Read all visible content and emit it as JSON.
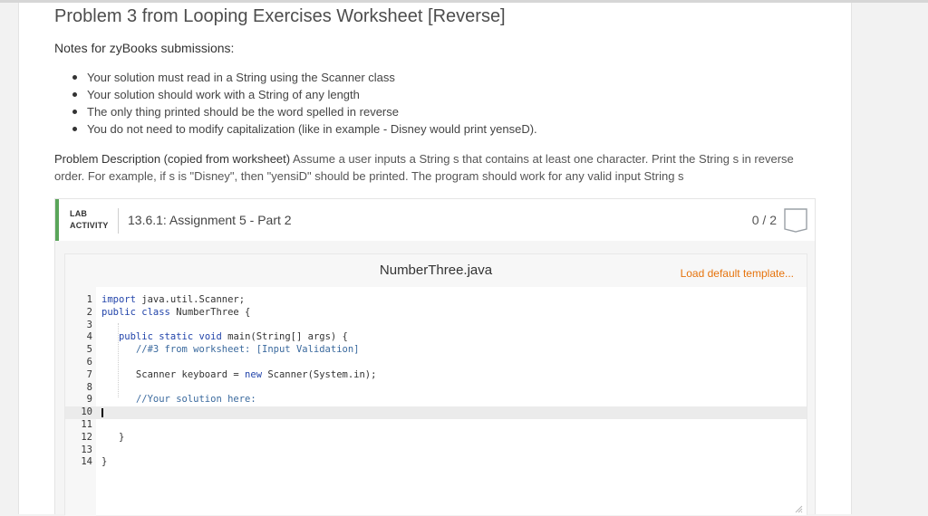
{
  "page": {
    "title": "Problem 3 from Looping Exercises Worksheet [Reverse]",
    "notes_heading": "Notes for zyBooks submissions:",
    "notes": [
      "Your solution must read in a String using the Scanner class",
      "Your solution should work with a String of any length",
      "The only thing printed should be the word spelled in reverse",
      "You do not need to modify capitalization (like in example - Disney would print yenseD)."
    ],
    "description_lead": "Problem Description (copied from worksheet)",
    "description_body": " Assume a user inputs a String s that contains at least one character. Print the String s in reverse order. For example, if s is \"Disney\", then \"yensiD\" should be printed. The program should work for any valid input String s"
  },
  "lab": {
    "label_line1": "LAB",
    "label_line2": "ACTIVITY",
    "name": "13.6.1: Assignment 5 - Part 2",
    "score": "0 / 2",
    "accent_color": "#5aa55a"
  },
  "editor": {
    "filename": "NumberThree.java",
    "load_template": "Load default template...",
    "active_line": 10,
    "lines": [
      {
        "n": "1",
        "text": "import java.util.Scanner;"
      },
      {
        "n": "2",
        "text": "public class NumberThree {"
      },
      {
        "n": "3",
        "text": ""
      },
      {
        "n": "4",
        "text": "   public static void main(String[] args) {"
      },
      {
        "n": "5",
        "text": "      //#3 from worksheet: [Input Validation]"
      },
      {
        "n": "6",
        "text": ""
      },
      {
        "n": "7",
        "text": "      Scanner keyboard = new Scanner(System.in);"
      },
      {
        "n": "8",
        "text": ""
      },
      {
        "n": "9",
        "text": "      //Your solution here:"
      },
      {
        "n": "10",
        "text": ""
      },
      {
        "n": "11",
        "text": ""
      },
      {
        "n": "12",
        "text": "   }"
      },
      {
        "n": "13",
        "text": ""
      },
      {
        "n": "14",
        "text": "}"
      }
    ]
  }
}
